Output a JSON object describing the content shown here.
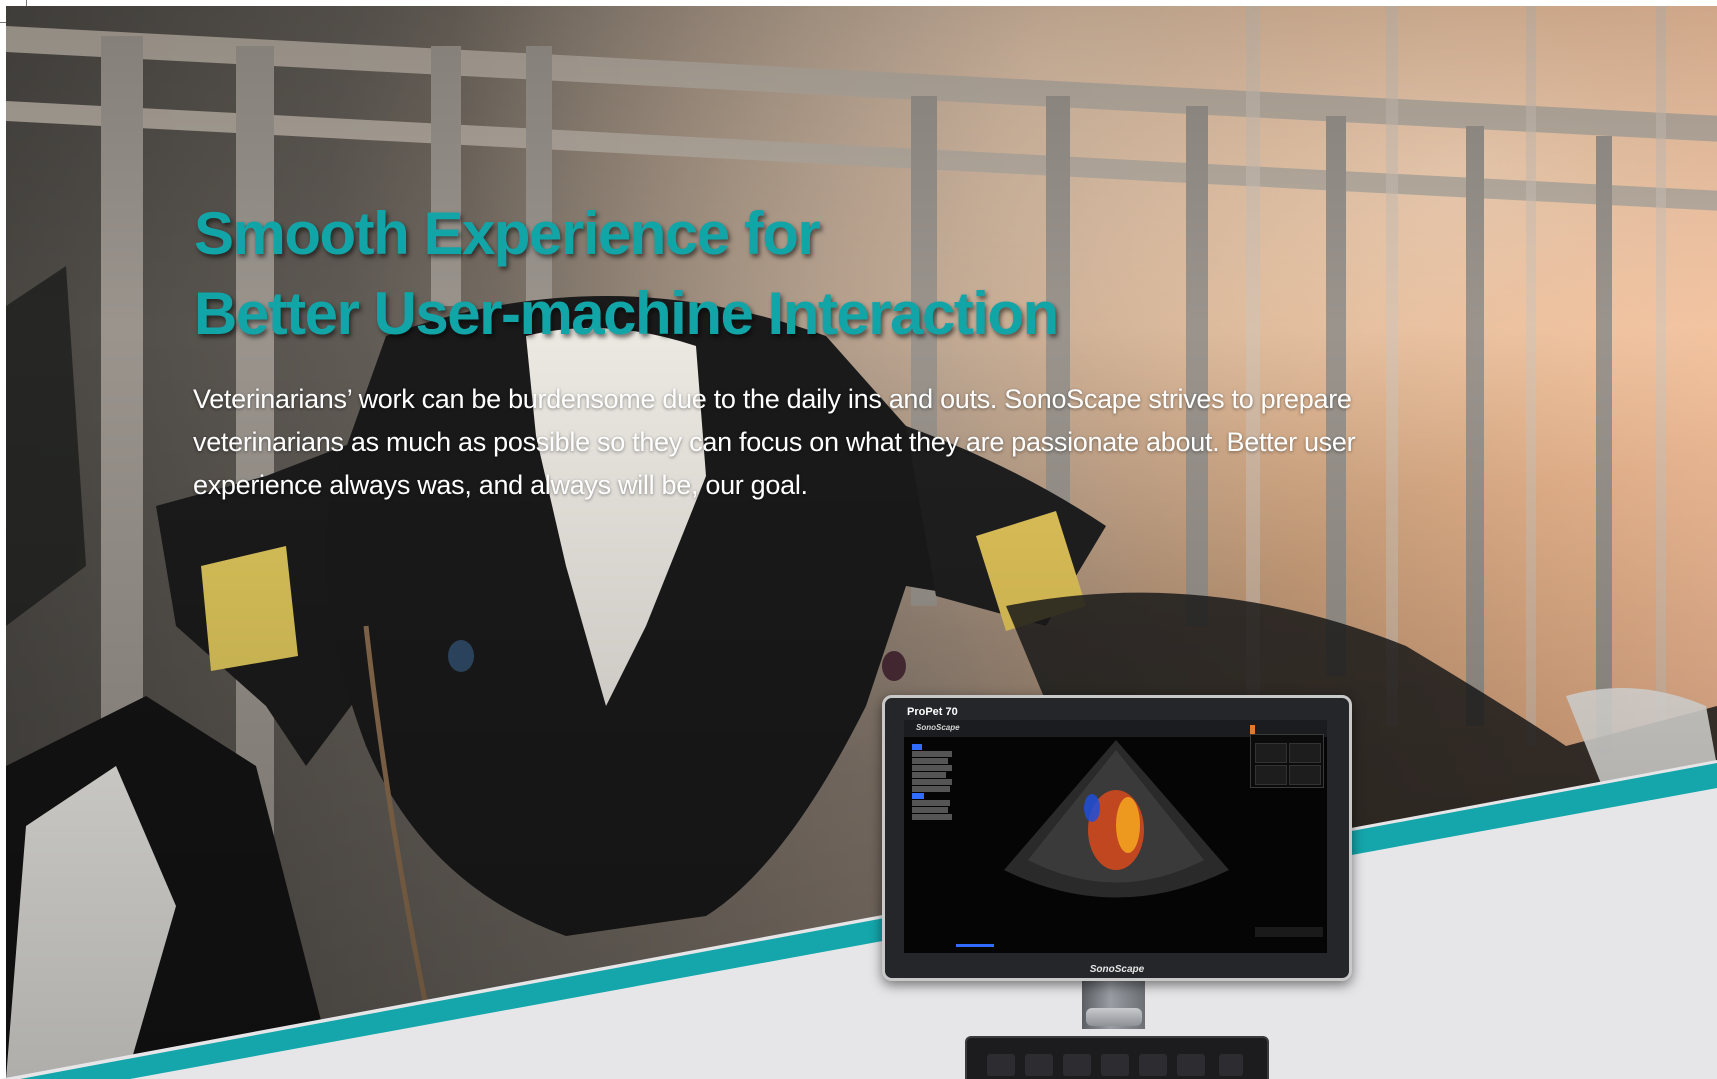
{
  "headline": {
    "line1": "Smooth Experience for",
    "line2": "Better User-machine Interaction"
  },
  "body_text": "Veterinarians’ work can be burdensome due to the daily ins and outs. SonoScape strives to prepare veterinarians as much as possible so they can focus on what they are passionate about. Better user experience always was, and always will be, our goal.",
  "device": {
    "model": "ProPet 70",
    "brand": "SonoScape"
  },
  "colors": {
    "accent_teal": "#12a5a8",
    "band_teal": "#14a6ab",
    "band_gray": "#e6e6e8",
    "body_text": "#ffffff"
  },
  "icons": [
    "ultrasound-fan-image",
    "cow-ear-tag-left",
    "cow-ear-tag-right",
    "console-probe-icon",
    "console-chevron-right-icon"
  ]
}
